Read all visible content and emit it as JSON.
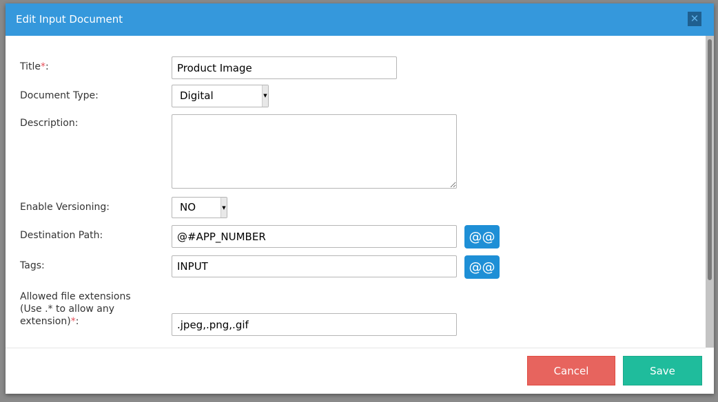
{
  "dialog": {
    "title": "Edit Input Document",
    "close_icon": "close-icon"
  },
  "fields": {
    "title": {
      "label": "Title",
      "required": "*",
      "colon": ":",
      "value": "Product Image"
    },
    "doc_type": {
      "label": "Document Type:",
      "value": "Digital"
    },
    "description": {
      "label": "Description:",
      "value": ""
    },
    "versioning": {
      "label": "Enable Versioning:",
      "value": "NO"
    },
    "dest_path": {
      "label": "Destination Path:",
      "value": "@#APP_NUMBER",
      "var_button": "@@"
    },
    "tags": {
      "label": "Tags:",
      "value": "INPUT",
      "var_button": "@@"
    },
    "extensions": {
      "label_line1": "Allowed file extensions",
      "label_line2": "(Use .* to allow any",
      "label_line3": "extension)",
      "required": "*",
      "colon": ":",
      "value": ".jpeg,.png,.gif"
    }
  },
  "footer": {
    "cancel": "Cancel",
    "save": "Save"
  },
  "colors": {
    "header": "#3598dc",
    "cancel": "#e7645e",
    "save": "#1fbc9c",
    "variable_button": "#1e8fd6"
  }
}
